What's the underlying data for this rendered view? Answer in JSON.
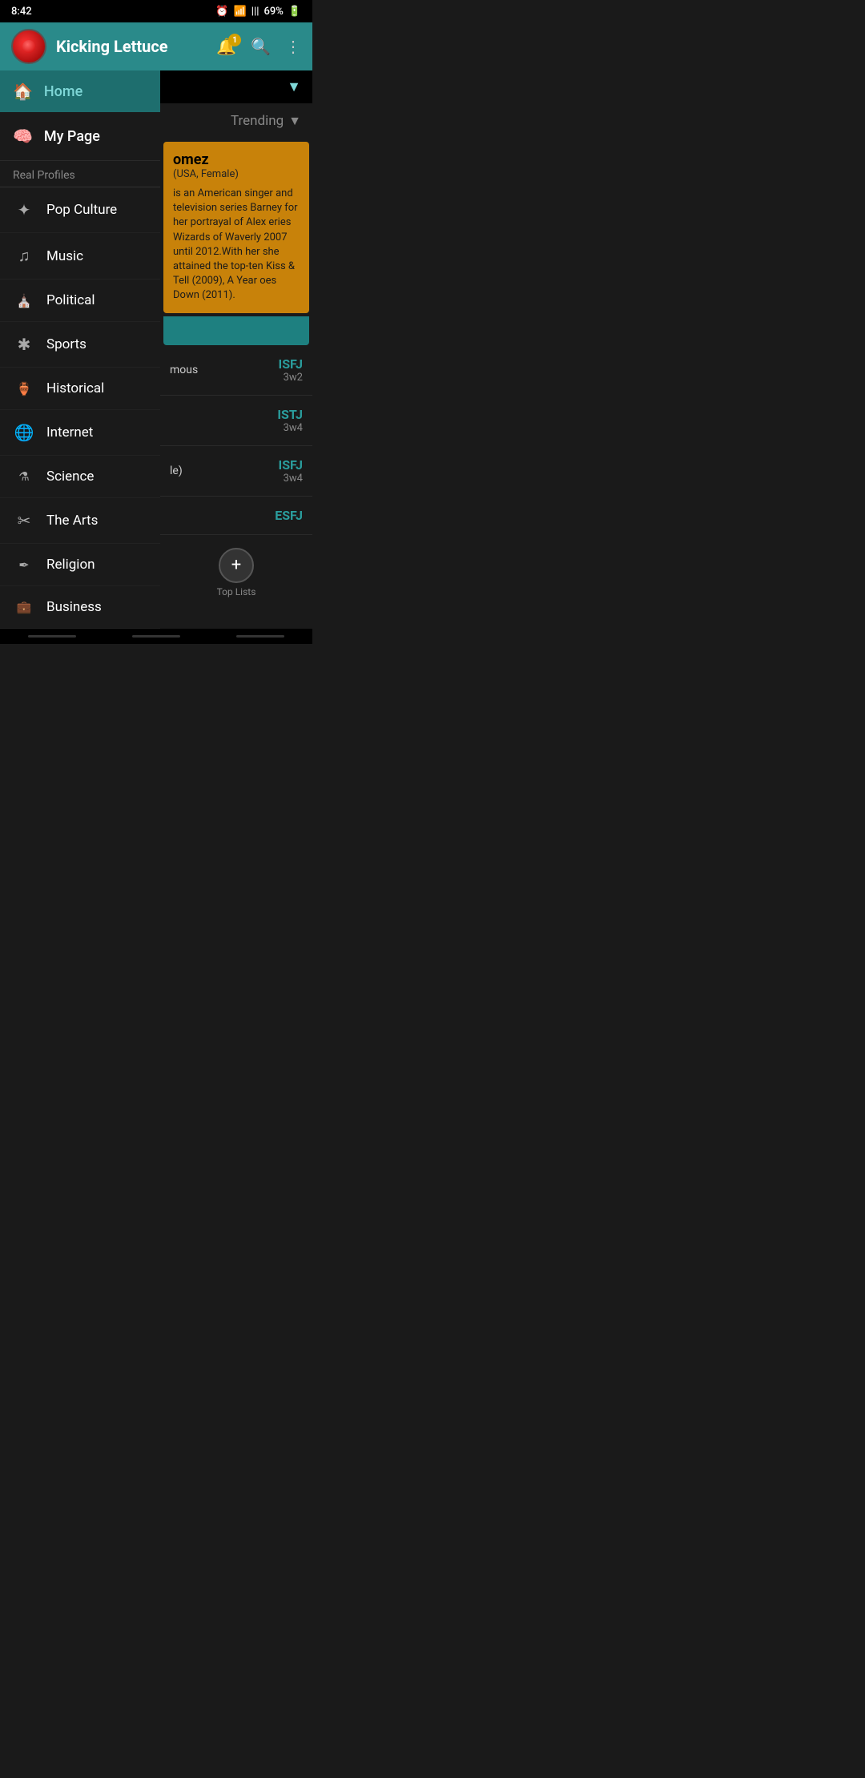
{
  "statusBar": {
    "time": "8:42",
    "battery": "69%",
    "signal": "|||"
  },
  "header": {
    "appName": "Kicking Lettuce",
    "notificationCount": "1"
  },
  "sidebar": {
    "homeLabel": "Home",
    "myPageLabel": "My Page",
    "sectionLabel": "Real Profiles",
    "items": [
      {
        "id": "pop-culture",
        "label": "Pop Culture",
        "icon": "✦"
      },
      {
        "id": "music",
        "label": "Music",
        "icon": "♪"
      },
      {
        "id": "political",
        "label": "Political",
        "icon": "🏛"
      },
      {
        "id": "sports",
        "label": "Sports",
        "icon": "✱"
      },
      {
        "id": "historical",
        "label": "Historical",
        "icon": "⚱"
      },
      {
        "id": "internet",
        "label": "Internet",
        "icon": "🌐"
      },
      {
        "id": "science",
        "label": "Science",
        "icon": "⚗"
      },
      {
        "id": "the-arts",
        "label": "The Arts",
        "icon": "✂"
      },
      {
        "id": "religion",
        "label": "Religion",
        "icon": "✒"
      },
      {
        "id": "business",
        "label": "Business",
        "icon": "💼"
      }
    ]
  },
  "content": {
    "trendingLabel": "Trending",
    "profileName": "omez",
    "profileMeta": "(USA, Female)",
    "profileDescription": "is an American singer and television series Barney for her portrayal of Alex eries Wizards of Waverly 2007 until 2012.With her she attained the top-ten Kiss & Tell (2009), A Year oes Down (2011).",
    "listItems": [
      {
        "left": "mous",
        "mbti": "ISFJ",
        "enneagram": "3w2"
      },
      {
        "left": "",
        "mbti": "ISTJ",
        "enneagram": "3w4"
      },
      {
        "left": "le)",
        "mbti": "ISFJ",
        "enneagram": "3w4"
      },
      {
        "left": "",
        "mbti": "ESFJ",
        "enneagram": ""
      }
    ],
    "fabLabel": "Top Lists"
  }
}
